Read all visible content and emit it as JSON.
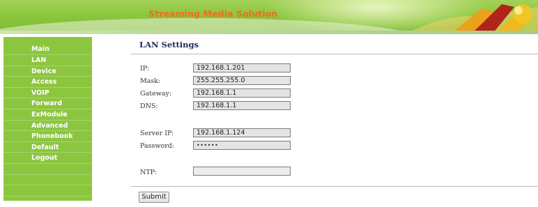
{
  "banner": {
    "title": "Streaming Media Solution"
  },
  "sidebar": {
    "items": [
      {
        "label": "Main"
      },
      {
        "label": "LAN"
      },
      {
        "label": "Device"
      },
      {
        "label": "Access"
      },
      {
        "label": "VOIP"
      },
      {
        "label": "Forward"
      },
      {
        "label": "ExModule"
      },
      {
        "label": "Advanced"
      },
      {
        "label": "Phonebook"
      },
      {
        "label": "Default"
      },
      {
        "label": "Logout"
      }
    ]
  },
  "main": {
    "title": "LAN Settings",
    "fields": {
      "ip": {
        "label": "IP:",
        "value": "192.168.1.201"
      },
      "mask": {
        "label": "Mask:",
        "value": "255.255.255.0"
      },
      "gateway": {
        "label": "Gateway:",
        "value": "192.168.1.1"
      },
      "dns": {
        "label": "DNS:",
        "value": "192.168.1.1"
      },
      "server_ip": {
        "label": "Server IP:",
        "value": "192.168.1.124"
      },
      "password": {
        "label": "Password:",
        "value": "••••••"
      },
      "ntp": {
        "label": "NTP:",
        "value": ""
      }
    },
    "submit_label": "Submit"
  },
  "colors": {
    "banner_green": "#8cc63f",
    "title_orange": "#f26b1d",
    "sidebar_green": "#8cc63f"
  }
}
